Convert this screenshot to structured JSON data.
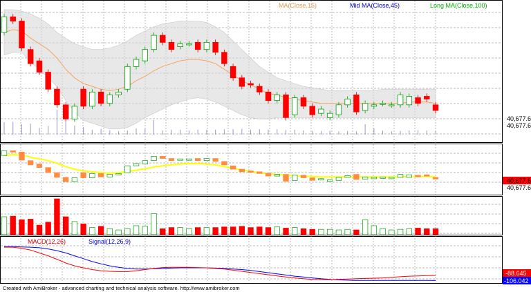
{
  "legend": {
    "ma15": "MA(Close,15)",
    "ma45": "Mid MA(Close,45)",
    "ma100": "Long MA(Close,100)",
    "macd": "MACD(12,26)",
    "signal": "Signal(12,26,9)"
  },
  "footer": "Created with AmiBroker - advanced charting and technical analysis software. http://www.amibroker.com",
  "price_labels": {
    "main_a": "40,677.6",
    "main_b": "40,677.6",
    "mini_a": "40,677.6",
    "mini_b": "40,677.6",
    "macd_a": "-88.645",
    "macd_b": "-106.042"
  },
  "colors": {
    "up": "#ffffff",
    "up_border": "#00a000",
    "down": "#ff0000",
    "ma15": "#f4a460",
    "ma45": "#0000c0",
    "ma100": "#00c000",
    "band": "#d8d8d8",
    "macd": "#ff0000",
    "signal": "#0000ff",
    "mini_up": "#ffff00",
    "mini_down": "#ff8c40"
  },
  "chart_data": {
    "type": "candlestick",
    "bars": 50,
    "ohlc_open": [
      40712,
      40723,
      40720,
      40700,
      40692,
      40684,
      40672,
      40661,
      40651,
      40672,
      40660,
      40670,
      40662,
      40668,
      40672,
      40688,
      40692,
      40700,
      40710,
      40705,
      40702,
      40704,
      40705,
      40700,
      40705,
      40698,
      40688,
      40680,
      40676,
      40674,
      40670,
      40664,
      40668,
      40654,
      40666,
      40660,
      40655,
      40652,
      40654,
      40661,
      40668,
      40657,
      40660,
      40662,
      40661,
      40661,
      40661,
      40666,
      40667,
      40661
    ],
    "ohlc_close": [
      40723,
      40720,
      40701,
      40690,
      40684,
      40672,
      40661,
      40651,
      40660,
      40660,
      40670,
      40662,
      40668,
      40670,
      40688,
      40693,
      40700,
      40710,
      40705,
      40700,
      40704,
      40704,
      40700,
      40705,
      40698,
      40690,
      40680,
      40674,
      40675,
      40670,
      40664,
      40668,
      40652,
      40666,
      40660,
      40654,
      40658,
      40655,
      40661,
      40665,
      40656,
      40662,
      40661,
      40662,
      40661,
      40668,
      40667,
      40662,
      40665,
      40657
    ],
    "volume": [
      30,
      31,
      25,
      26,
      16,
      21,
      60,
      30,
      22,
      18,
      12,
      14,
      10,
      8,
      10,
      15,
      14,
      35,
      10,
      12,
      12,
      10,
      12,
      12,
      12,
      13,
      13,
      14,
      12,
      13,
      12,
      13,
      11,
      12,
      10,
      9,
      9,
      9,
      8,
      9,
      8,
      25,
      15,
      10,
      8,
      9,
      10,
      11,
      10,
      10
    ],
    "ma15": [
      40712,
      40714,
      40713,
      40708,
      40704,
      40700,
      40694,
      40686,
      40680,
      40676,
      40674,
      40672,
      40671,
      40672,
      40674,
      40678,
      40681,
      40685,
      40688,
      40690,
      40692,
      40693,
      40693,
      40692,
      40690,
      40686,
      40682,
      40678,
      40675,
      40672,
      40669,
      40668,
      40666,
      40665,
      40664,
      40663,
      40662,
      40662,
      40662,
      40662,
      40662,
      40662,
      40662,
      40662,
      40662,
      40662,
      40663,
      40663,
      40663,
      40662
    ],
    "band_upper": [
      40728,
      40728,
      40727,
      40725,
      40722,
      40718,
      40712,
      40708,
      40704,
      40702,
      40700,
      40700,
      40701,
      40703,
      40706,
      40710,
      40713,
      40716,
      40718,
      40719,
      40720,
      40720,
      40720,
      40719,
      40716,
      40712,
      40706,
      40700,
      40694,
      40688,
      40684,
      40680,
      40678,
      40676,
      40674,
      40673,
      40672,
      40671,
      40671,
      40671,
      40671,
      40671,
      40671,
      40672,
      40672,
      40672,
      40672,
      40672,
      40672,
      40672
    ],
    "band_lower": [
      40696,
      40698,
      40698,
      40691,
      40686,
      40680,
      40674,
      40664,
      40656,
      40650,
      40648,
      40646,
      40644,
      40644,
      40645,
      40648,
      40652,
      40655,
      40658,
      40661,
      40663,
      40665,
      40666,
      40665,
      40663,
      40660,
      40657,
      40654,
      40652,
      40651,
      40651,
      40652,
      40652,
      40652,
      40652,
      40652,
      40652,
      40652,
      40652,
      40652,
      40652,
      40652,
      40652,
      40652,
      40652,
      40652,
      40652,
      40652,
      40652,
      40652
    ],
    "macd": [
      10,
      10,
      6,
      0,
      -10,
      -20,
      -32,
      -45,
      -55,
      -62,
      -68,
      -72,
      -74,
      -75,
      -75,
      -72,
      -68,
      -64,
      -61,
      -60,
      -60,
      -60,
      -61,
      -62,
      -64,
      -66,
      -70,
      -74,
      -78,
      -82,
      -86,
      -90,
      -94,
      -97,
      -100,
      -102,
      -103,
      -103,
      -102,
      -101,
      -100,
      -99,
      -98,
      -97,
      -95,
      -93,
      -91,
      -90,
      -89,
      -88.645
    ],
    "signal": [
      12,
      12,
      11,
      10,
      8,
      4,
      -2,
      -10,
      -20,
      -30,
      -40,
      -48,
      -55,
      -60,
      -64,
      -66,
      -66,
      -65,
      -64,
      -63,
      -62,
      -62,
      -62,
      -62,
      -63,
      -64,
      -66,
      -68,
      -71,
      -75,
      -79,
      -83,
      -87,
      -91,
      -94,
      -97,
      -100,
      -102,
      -104,
      -105,
      -106,
      -106,
      -106,
      -106,
      -106,
      -106,
      -106,
      -106,
      -106,
      -106.042
    ],
    "last_price": "40,677.6",
    "last_macd": "-88.645",
    "last_signal": "-106.042"
  }
}
